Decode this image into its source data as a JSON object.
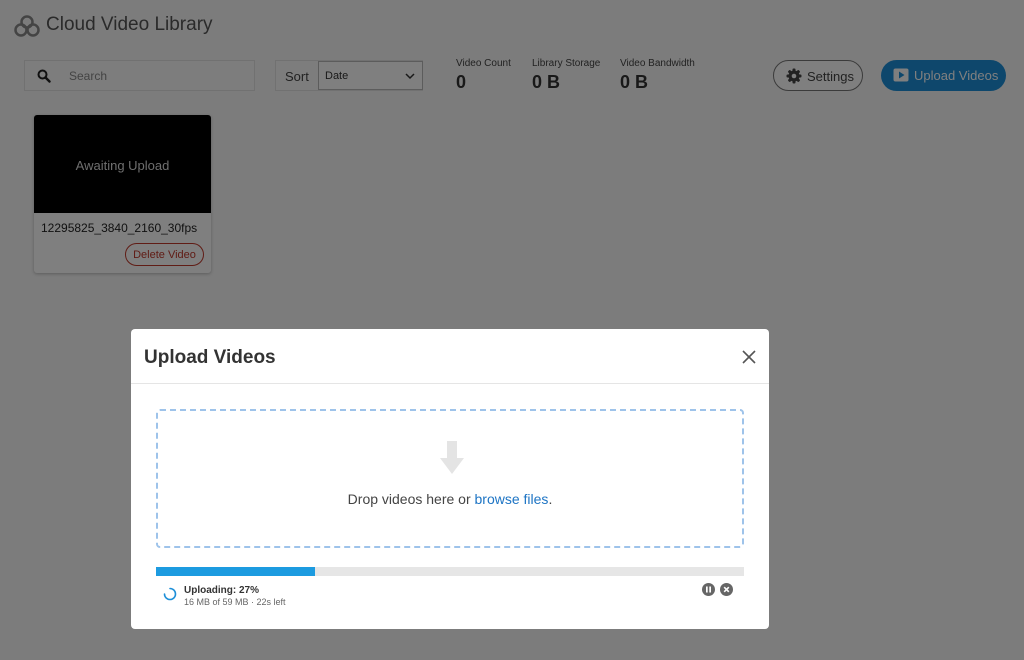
{
  "app": {
    "title": "Cloud Video Library",
    "logo_icon": "cloud-circles-icon"
  },
  "toolbar": {
    "search_placeholder": "Search",
    "search_value": "",
    "sort_label": "Sort",
    "sort_selected": "Date",
    "settings_label": "Settings",
    "upload_label": "Upload Videos",
    "accent_color": "#1d8fd8"
  },
  "stats": [
    {
      "label": "Video Count",
      "value": "0"
    },
    {
      "label": "Library Storage",
      "value": "0 B"
    },
    {
      "label": "Video Bandwidth",
      "value": "0 B"
    }
  ],
  "videos": [
    {
      "thumbnail_text": "Awaiting Upload",
      "name": "12295825_3840_2160_30fps",
      "delete_label": "Delete Video"
    }
  ],
  "modal": {
    "title": "Upload Videos",
    "drop_text": "Drop videos here or ",
    "browse_link": "browse files",
    "drop_suffix": ".",
    "progress_fraction": 0.27,
    "status_text": "Uploading: 27%",
    "detail_text": "16 MB of 59 MB · 22s left"
  }
}
